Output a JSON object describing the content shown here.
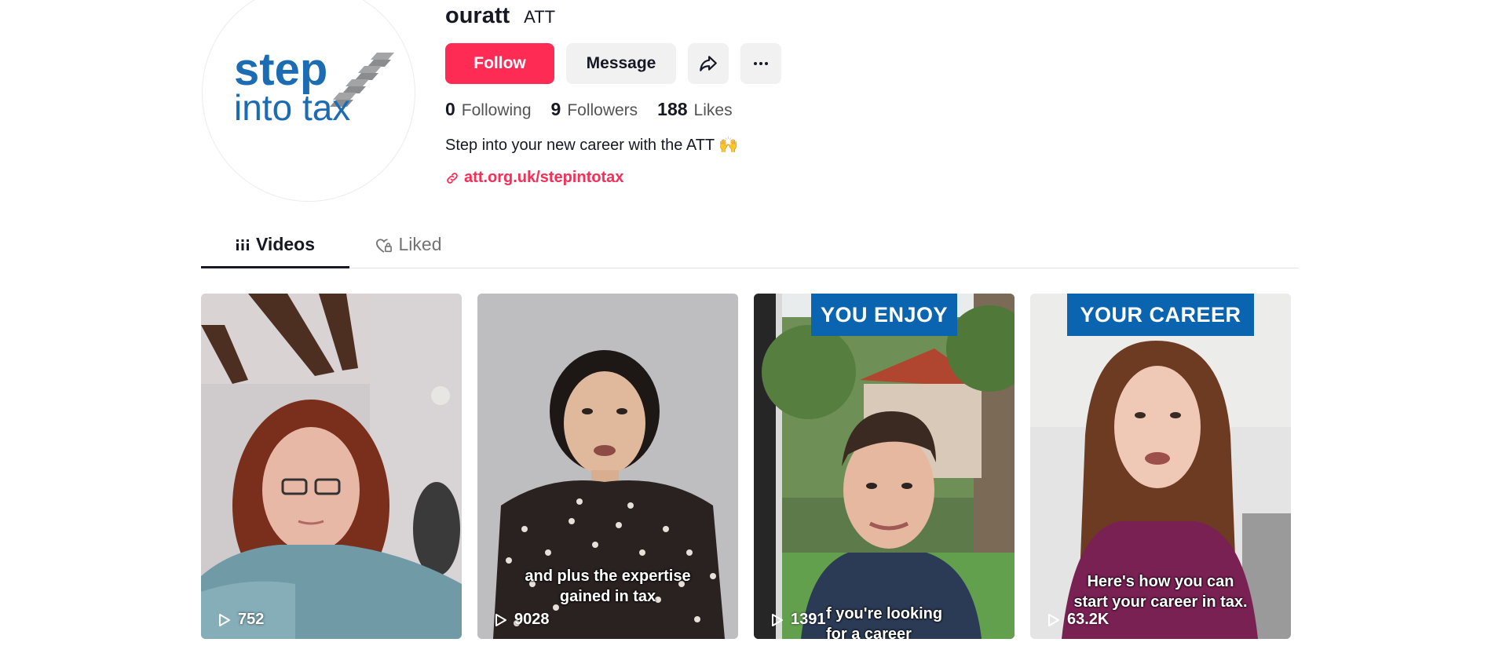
{
  "profile": {
    "logo_line1": "step",
    "logo_line2": "into tax",
    "username": "ouratt",
    "nickname": "ATT",
    "bio": "Step into your new career with the ATT 🙌",
    "link": "att.org.uk/stepintotax"
  },
  "buttons": {
    "follow": "Follow",
    "message": "Message",
    "share_icon": "share-icon",
    "more_icon": "more-icon"
  },
  "stats": [
    {
      "value": "0",
      "label": "Following"
    },
    {
      "value": "9",
      "label": "Followers"
    },
    {
      "value": "188",
      "label": "Likes"
    }
  ],
  "tabs": [
    {
      "label": "Videos",
      "icon": "grid-icon",
      "active": true
    },
    {
      "label": "Liked",
      "icon": "heart-lock-icon",
      "active": false
    }
  ],
  "videos": [
    {
      "views": "752",
      "banner": "",
      "caption": ""
    },
    {
      "views": "9028",
      "banner": "",
      "caption": "and plus the expertise\ngained in tax"
    },
    {
      "views": "1391",
      "banner": "YOU ENJOY",
      "caption": "f you're looking\nfor a career"
    },
    {
      "views": "63.2K",
      "banner": "YOUR CAREER",
      "caption": "Here's how you can\nstart your career in tax."
    }
  ],
  "colors": {
    "accent": "#fe2c55",
    "banner_blue": "#0a64b0",
    "logo_blue": "#1b6cb3"
  }
}
